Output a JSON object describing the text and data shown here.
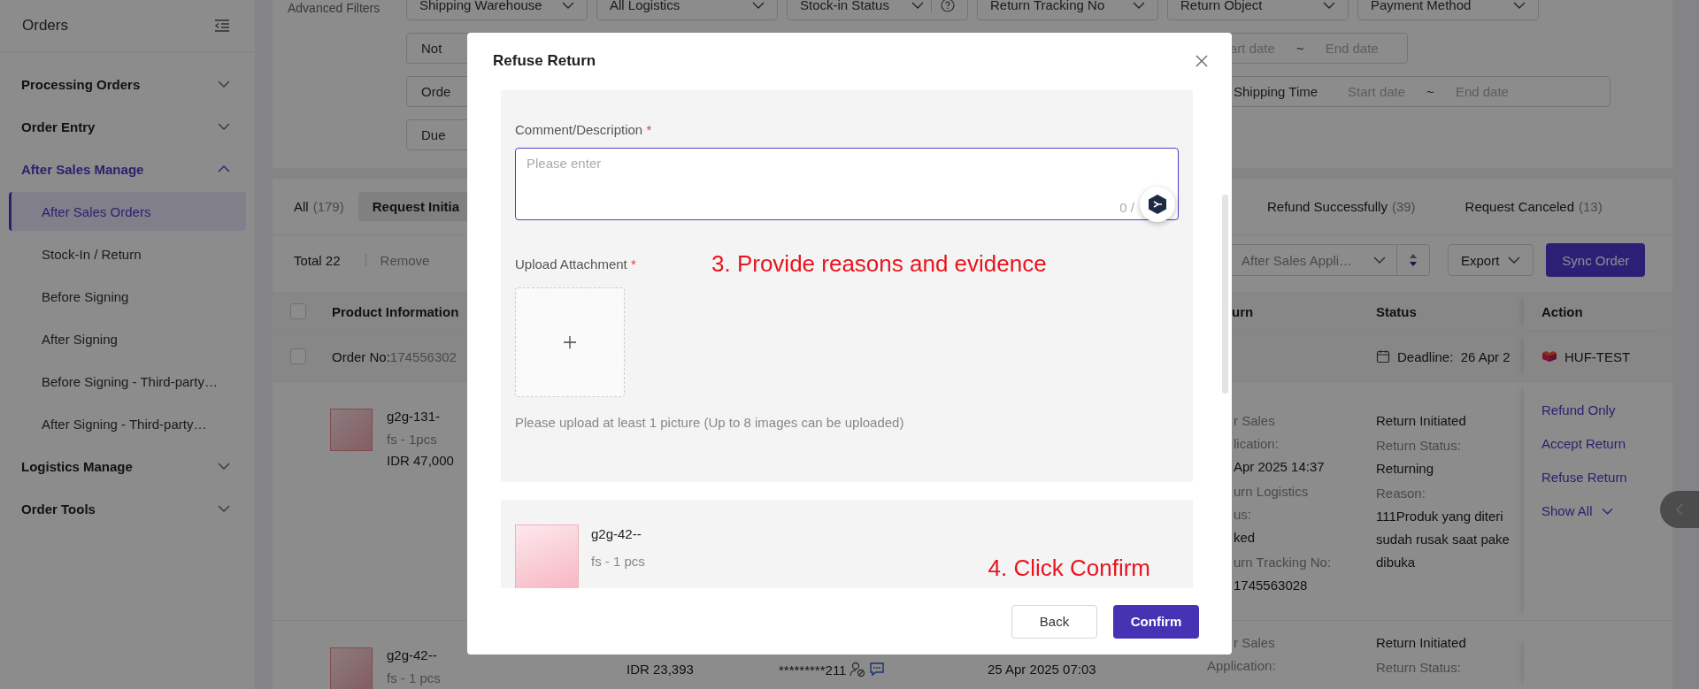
{
  "sidebar": {
    "title": "Orders",
    "items": [
      {
        "label": "Processing Orders",
        "expanded": false
      },
      {
        "label": "Order Entry",
        "expanded": false
      },
      {
        "label": "After Sales Manage",
        "expanded": true,
        "children": [
          {
            "label": "After Sales Orders",
            "selected": true
          },
          {
            "label": "Stock-In / Return",
            "selected": false
          },
          {
            "label": "Before Signing",
            "selected": false
          },
          {
            "label": "After Signing",
            "selected": false
          },
          {
            "label": "Before Signing - Third-party…",
            "selected": false
          },
          {
            "label": "After Signing - Third-party…",
            "selected": false
          }
        ]
      },
      {
        "label": "Logistics Manage",
        "expanded": false
      },
      {
        "label": "Order Tools",
        "expanded": false
      }
    ]
  },
  "filters": {
    "label": "Advanced Filters",
    "selects": [
      {
        "label": "Shipping Warehouse",
        "help": false
      },
      {
        "label": "All Logistics",
        "help": false
      },
      {
        "label": "Stock-in Status",
        "help": true
      },
      {
        "label": "Return Tracking No",
        "help": false
      },
      {
        "label": "Return Object",
        "help": false
      },
      {
        "label": "Payment Method",
        "help": false
      }
    ],
    "rows": [
      {
        "left": "Not",
        "right": {
          "kind": "date_range",
          "start": "art date",
          "separator": "~",
          "end": "End date"
        }
      },
      {
        "left": "Orde",
        "right": {
          "kind": "labeled_date_range",
          "label": "Shipping Time",
          "start": "Start date",
          "separator": "~",
          "end": "End date"
        }
      },
      {
        "left": "Due"
      }
    ]
  },
  "tabs_left": [
    {
      "label": "All",
      "count": "(179)",
      "selected": false
    },
    {
      "label": "Request Initia",
      "selected": true
    }
  ],
  "tabs_right": [
    {
      "label": "Refund Successfully",
      "count": "(39)",
      "selected": false
    },
    {
      "label": "Request Canceled",
      "count": "(13)",
      "selected": false
    }
  ],
  "toolbar": {
    "total": "Total 22",
    "remove": "Remove",
    "sort": "After Sales Appli…",
    "export": "Export",
    "sync": "Sync Order"
  },
  "table": {
    "header_checked": false,
    "columns": {
      "product": "Product Information",
      "return": "urn",
      "status": "Status",
      "action": "Action"
    },
    "order": {
      "checked": false,
      "label": "Order No:",
      "number": "174556302",
      "deadline_label": "Deadline:",
      "deadline": "26 Apr 2",
      "shop": "HUF-TEST"
    },
    "rows": [
      {
        "name": "g2g-131-",
        "spec": "fs - 1pcs",
        "price": "IDR 47,000",
        "return_lines": [
          {
            "kind": "label",
            "text": "r Sales"
          },
          {
            "kind": "label",
            "text": "lication:"
          },
          {
            "kind": "value",
            "text": "Apr 2025 14:37"
          },
          {
            "kind": "label",
            "text": "urn Logistics"
          },
          {
            "kind": "label",
            "text": "us:"
          },
          {
            "kind": "value",
            "text": "ked"
          },
          {
            "kind": "label",
            "text": "urn Tracking No:"
          },
          {
            "kind": "value",
            "text": "1745563028"
          }
        ],
        "status_lines": [
          {
            "kind": "value",
            "text": "Return Initiated"
          },
          {
            "kind": "label",
            "text": "Return Status:"
          },
          {
            "kind": "value",
            "text": "Returning"
          },
          {
            "kind": "label",
            "text": "Reason:"
          },
          {
            "kind": "paragraph",
            "lines": [
              "111Produk yang diteri",
              "sudah rusak saat pake",
              "dibuka"
            ]
          }
        ],
        "actions": [
          {
            "kind": "link",
            "label": "Refund Only"
          },
          {
            "kind": "link",
            "label": "Accept Return"
          },
          {
            "kind": "link",
            "label": "Refuse Return"
          },
          {
            "kind": "more",
            "label": "Show All"
          }
        ]
      },
      {
        "name": "g2g-42--",
        "spec": "fs - 1 pcs",
        "amount": "IDR 23,393",
        "buyer": "*********211",
        "time": "25 Apr 2025 07:03",
        "return_lines": [
          {
            "kind": "label",
            "text": "r Sales"
          },
          {
            "kind": "label",
            "text": "Application:"
          }
        ],
        "status_lines": [
          {
            "kind": "value",
            "text": "Return Initiated"
          },
          {
            "kind": "label",
            "text": "Return Status:"
          }
        ]
      }
    ]
  },
  "modal": {
    "title": "Refuse Return",
    "comment": {
      "label": "Comment/Description",
      "required_mark": "*",
      "placeholder": "Please enter",
      "counter": "0 /"
    },
    "upload": {
      "label": "Upload Attachment",
      "required_mark": "*",
      "annotation": "3. Provide reasons and evidence",
      "hint": "Please upload at least 1 picture (Up to 8 images can be uploaded)"
    },
    "product": {
      "name": "g2g-42--",
      "spec": "fs - 1 pcs",
      "annotation": "4. Click Confirm"
    },
    "buttons": [
      {
        "label": "Back",
        "kind": "secondary"
      },
      {
        "label": "Confirm",
        "kind": "primary"
      }
    ]
  }
}
